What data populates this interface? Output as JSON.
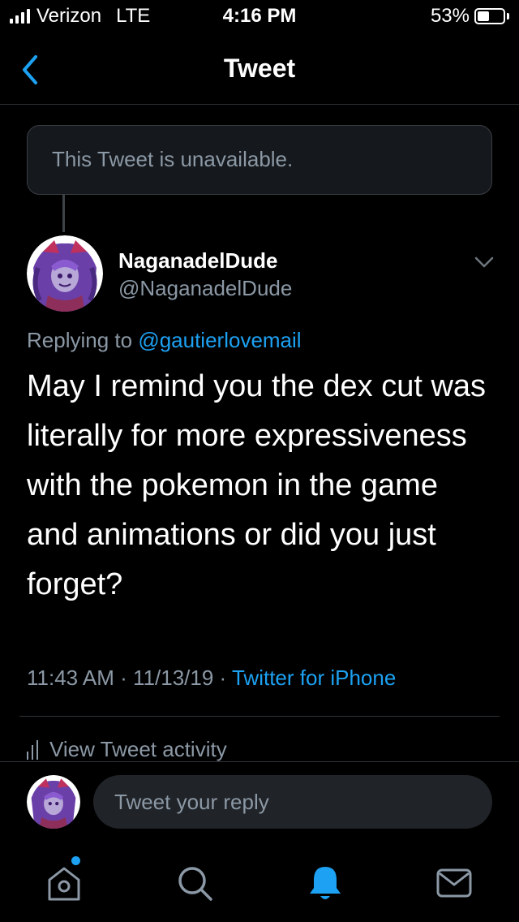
{
  "status_bar": {
    "carrier": "Verizon",
    "network": "LTE",
    "time": "4:16 PM",
    "battery": "53%",
    "battery_level": 0.53
  },
  "nav": {
    "title": "Tweet",
    "back_icon": "chevron-left-icon"
  },
  "unavailable": {
    "text": "This Tweet is unavailable."
  },
  "tweet": {
    "author_name": "NaganadelDude",
    "author_handle": "@NaganadelDude",
    "replying_prefix": "Replying to ",
    "replying_to": "@gautierlovemail",
    "body": "May I remind you the dex cut was literally for more expressiveness with the pokemon in the game and animations or did you just forget?",
    "time": "11:43 AM",
    "date": "11/13/19",
    "separator": " · ",
    "source": "Twitter for iPhone",
    "activity_label": "View Tweet activity"
  },
  "reply": {
    "placeholder": "Tweet your reply"
  },
  "tabs": [
    {
      "name": "home",
      "icon": "home-icon",
      "active": false,
      "has_dot": true
    },
    {
      "name": "search",
      "icon": "search-icon",
      "active": false
    },
    {
      "name": "notifications",
      "icon": "bell-icon",
      "active": true
    },
    {
      "name": "messages",
      "icon": "mail-icon",
      "active": false
    }
  ],
  "colors": {
    "background": "#000000",
    "accent": "#1da1f2",
    "secondary_text": "#8b98a5",
    "divider": "#2f3336"
  }
}
